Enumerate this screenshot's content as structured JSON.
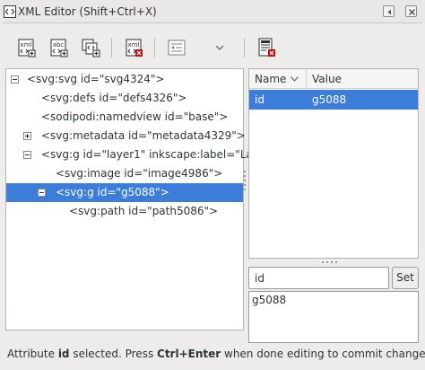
{
  "window": {
    "title": "XML Editor (Shift+Ctrl+X)"
  },
  "titlebar_buttons": [
    {
      "icon": "dock-left-icon"
    },
    {
      "icon": "close-icon"
    }
  ],
  "toolbar": {
    "buttons": [
      {
        "icon": "new-element-node-icon",
        "glyph_text": "xml"
      },
      {
        "icon": "new-text-node-icon",
        "glyph_text": "abc"
      },
      {
        "icon": "duplicate-node-icon"
      },
      {
        "icon": "delete-node-icon",
        "glyph_text": "xml"
      },
      {
        "icon": "unindent-node-icon"
      },
      {
        "icon": "more-options-chevron-icon"
      },
      {
        "icon": "delete-attribute-icon"
      }
    ]
  },
  "tree": {
    "nodes": [
      {
        "text": "<svg:svg id=\"svg4324\">",
        "expander": "minus"
      },
      {
        "text": "<svg:defs id=\"defs4326\">",
        "expander": "none"
      },
      {
        "text": "<sodipodi:namedview id=\"base\">",
        "expander": "none"
      },
      {
        "text": "<svg:metadata id=\"metadata4329\">",
        "expander": "plus"
      },
      {
        "text": "<svg:g id=\"layer1\" inkscape:label=\"La",
        "expander": "minus"
      },
      {
        "text": "<svg:image id=\"image4986\">",
        "expander": "none"
      },
      {
        "text": "<svg:g id=\"g5088\">",
        "expander": "minus",
        "selected": true
      },
      {
        "text": "<svg:path id=\"path5086\">",
        "expander": "none"
      }
    ]
  },
  "attributes": {
    "columns": {
      "name": "Name",
      "value": "Value"
    },
    "rows": [
      {
        "name": "id",
        "value": "g5088",
        "selected": true
      }
    ]
  },
  "editor": {
    "attr_name_value": "id",
    "set_label": "Set",
    "attr_value_text": "g5088"
  },
  "status": {
    "prefix": "Attribute ",
    "attr": "id",
    "middle": " selected. Press ",
    "shortcut": "Ctrl+Enter",
    "suffix": " when done editing to commit changes."
  },
  "colors": {
    "selection": "#3b7dd8",
    "window_bg": "#edeceb",
    "delete_red": "#cc0000"
  }
}
